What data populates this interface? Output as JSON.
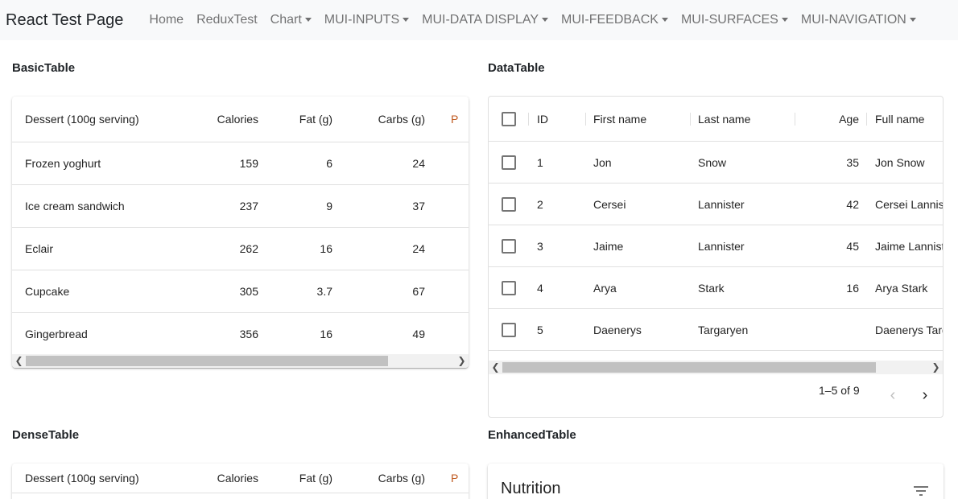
{
  "navbar": {
    "brand": "React Test Page",
    "items": [
      {
        "label": "Home",
        "dropdown": false
      },
      {
        "label": "ReduxTest",
        "dropdown": false
      },
      {
        "label": "Chart",
        "dropdown": true
      },
      {
        "label": "MUI-INPUTS",
        "dropdown": true
      },
      {
        "label": "MUI-DATA DISPLAY",
        "dropdown": true
      },
      {
        "label": "MUI-FEEDBACK",
        "dropdown": true
      },
      {
        "label": "MUI-SURFACES",
        "dropdown": true
      },
      {
        "label": "MUI-NAVIGATION",
        "dropdown": true
      }
    ]
  },
  "basic_table": {
    "title": "BasicTable",
    "headers": [
      "Dessert (100g serving)",
      "Calories",
      "Fat (g)",
      "Carbs (g)",
      "P"
    ],
    "rows": [
      [
        "Frozen yoghurt",
        "159",
        "6",
        "24"
      ],
      [
        "Ice cream sandwich",
        "237",
        "9",
        "37"
      ],
      [
        "Eclair",
        "262",
        "16",
        "24"
      ],
      [
        "Cupcake",
        "305",
        "3.7",
        "67"
      ],
      [
        "Gingerbread",
        "356",
        "16",
        "49"
      ]
    ]
  },
  "data_table": {
    "title": "DataTable",
    "headers": [
      "ID",
      "First name",
      "Last name",
      "Age",
      "Full name"
    ],
    "rows": [
      [
        "1",
        "Jon",
        "Snow",
        "35",
        "Jon Snow"
      ],
      [
        "2",
        "Cersei",
        "Lannister",
        "42",
        "Cersei Lannister"
      ],
      [
        "3",
        "Jaime",
        "Lannister",
        "45",
        "Jaime Lannister"
      ],
      [
        "4",
        "Arya",
        "Stark",
        "16",
        "Arya Stark"
      ],
      [
        "5",
        "Daenerys",
        "Targaryen",
        "",
        "Daenerys Targaryen"
      ]
    ],
    "pagination": "1–5 of 9"
  },
  "dense_table": {
    "title": "DenseTable",
    "headers": [
      "Dessert (100g serving)",
      "Calories",
      "Fat (g)",
      "Carbs (g)",
      "P"
    ]
  },
  "enhanced_table": {
    "title": "EnhancedTable",
    "toolbar_title": "Nutrition"
  },
  "icons": {
    "caret": "caret-down-icon",
    "scroll_left": "chevron-left-icon",
    "scroll_right": "chevron-right-icon",
    "prev_page": "chevron-left-icon",
    "next_page": "chevron-right-icon",
    "filter": "filter-list-icon",
    "checkbox": "checkbox-blank-icon"
  },
  "colors": {
    "navbar_bg": "#f8f9fa",
    "accent_partial_header": "#c05a20"
  }
}
